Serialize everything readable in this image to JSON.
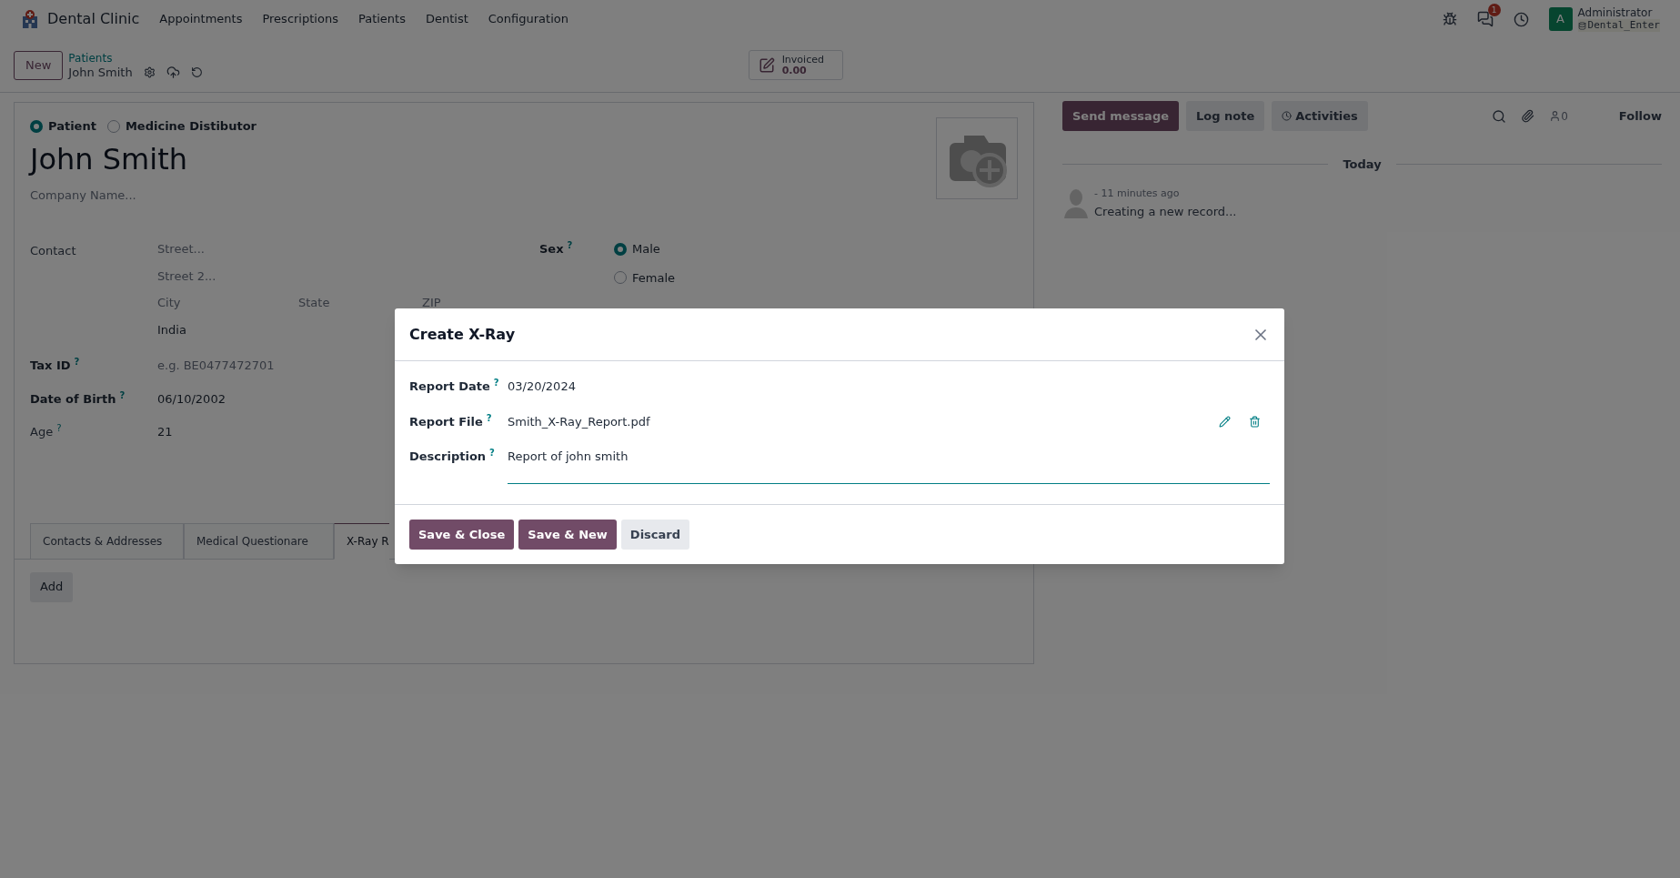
{
  "navbar": {
    "app_name": "Dental Clinic",
    "menu": [
      "Appointments",
      "Prescriptions",
      "Patients",
      "Dentist",
      "Configuration"
    ],
    "messages_count": "1",
    "user": {
      "avatar_letter": "A",
      "name": "Administrator",
      "database": "Dental_Enter"
    }
  },
  "control_panel": {
    "new_button": "New",
    "breadcrumb": "Patients",
    "record": "John Smith",
    "stat_button": {
      "label": "Invoiced",
      "value": "0.00"
    }
  },
  "form": {
    "company_type": [
      {
        "label": "Patient",
        "selected": true
      },
      {
        "label": "Medicine Distibutor",
        "selected": false
      }
    ],
    "name": "John Smith",
    "company_placeholder": "Company Name...",
    "contact": {
      "label": "Contact",
      "street": "Street...",
      "street2": "Street 2...",
      "city": "City",
      "state": "State",
      "zip": "ZIP",
      "country": "India"
    },
    "fields": [
      {
        "label": "Tax ID",
        "help": "?",
        "bold": true,
        "placeholder": "e.g. BE0477472701"
      },
      {
        "label": "Date of Birth",
        "help": "?",
        "bold": true,
        "value": "06/10/2002"
      },
      {
        "label": "Age",
        "help": "?",
        "bold": false,
        "value": "21"
      }
    ],
    "sex": {
      "label": "Sex",
      "help": "?",
      "options": [
        {
          "label": "Male",
          "selected": true
        },
        {
          "label": "Female",
          "selected": false
        }
      ]
    },
    "tabs": [
      {
        "label": "Contacts & Addresses",
        "selected": false
      },
      {
        "label": "Medical Questionare",
        "selected": false
      },
      {
        "label": "X-Ray R",
        "selected": true
      }
    ],
    "add_button": "Add"
  },
  "chatter": {
    "buttons": [
      {
        "label": "Send message",
        "kind": "primary"
      },
      {
        "label": "Log note",
        "kind": "secondary"
      },
      {
        "label": "Activities",
        "kind": "activities"
      }
    ],
    "followers": "0",
    "follow": "Follow",
    "date_separator": "Today",
    "messages": [
      {
        "time": "- 11 minutes ago",
        "body": "Creating a new record..."
      }
    ]
  },
  "dialog": {
    "title": "Create X-Ray",
    "fields": [
      {
        "label": "Report Date",
        "help": "?",
        "value": "03/20/2024",
        "kind": "date"
      },
      {
        "label": "Report File",
        "help": "?",
        "value": "Smith_X-Ray_Report.pdf",
        "kind": "file"
      },
      {
        "label": "Description",
        "help": "?",
        "value": "Report of john smith",
        "kind": "text"
      }
    ],
    "buttons": [
      {
        "label": "Save & Close",
        "kind": "primary"
      },
      {
        "label": "Save & New",
        "kind": "primary"
      },
      {
        "label": "Discard",
        "kind": "secondary"
      }
    ]
  }
}
